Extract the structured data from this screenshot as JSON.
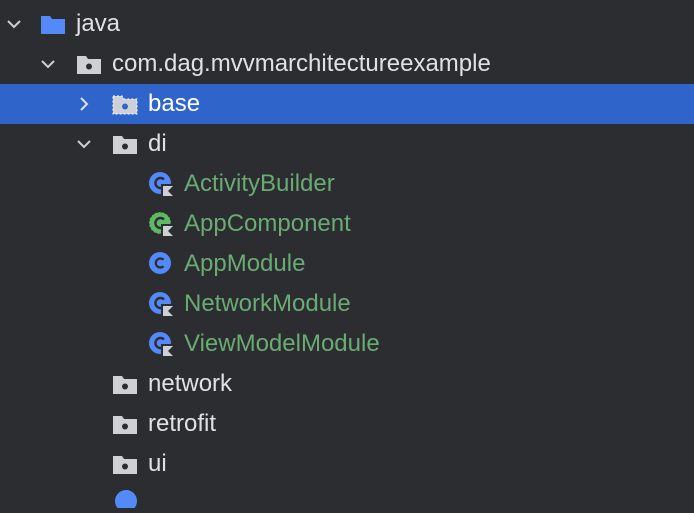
{
  "tree": {
    "java": {
      "label": "java",
      "icon": "folder-source-icon",
      "expanded": true
    },
    "package_root": {
      "label": "com.dag.mvvmarchitectureexample",
      "icon": "package-icon",
      "expanded": true
    },
    "base": {
      "label": "base",
      "icon": "package-icon",
      "expanded": false,
      "selected": true
    },
    "di": {
      "label": "di",
      "icon": "package-icon",
      "expanded": true
    },
    "di_children": [
      {
        "label": "ActivityBuilder",
        "icon": "kotlin-class-icon"
      },
      {
        "label": "AppComponent",
        "icon": "kotlin-interface-icon"
      },
      {
        "label": "AppModule",
        "icon": "class-icon"
      },
      {
        "label": "NetworkModule",
        "icon": "kotlin-class-icon"
      },
      {
        "label": "ViewModelModule",
        "icon": "kotlin-class-icon"
      }
    ],
    "network": {
      "label": "network",
      "icon": "package-icon"
    },
    "retrofit": {
      "label": "retrofit",
      "icon": "package-icon"
    },
    "ui": {
      "label": "ui",
      "icon": "package-icon"
    }
  },
  "colors": {
    "background": "#2b2d30",
    "selection": "#2f65ca",
    "text": "#dfe1e5",
    "class_text": "#6aab73",
    "folder_blue": "#548af7",
    "package_gray": "#ced0d6",
    "class_blue": "#548af7"
  }
}
